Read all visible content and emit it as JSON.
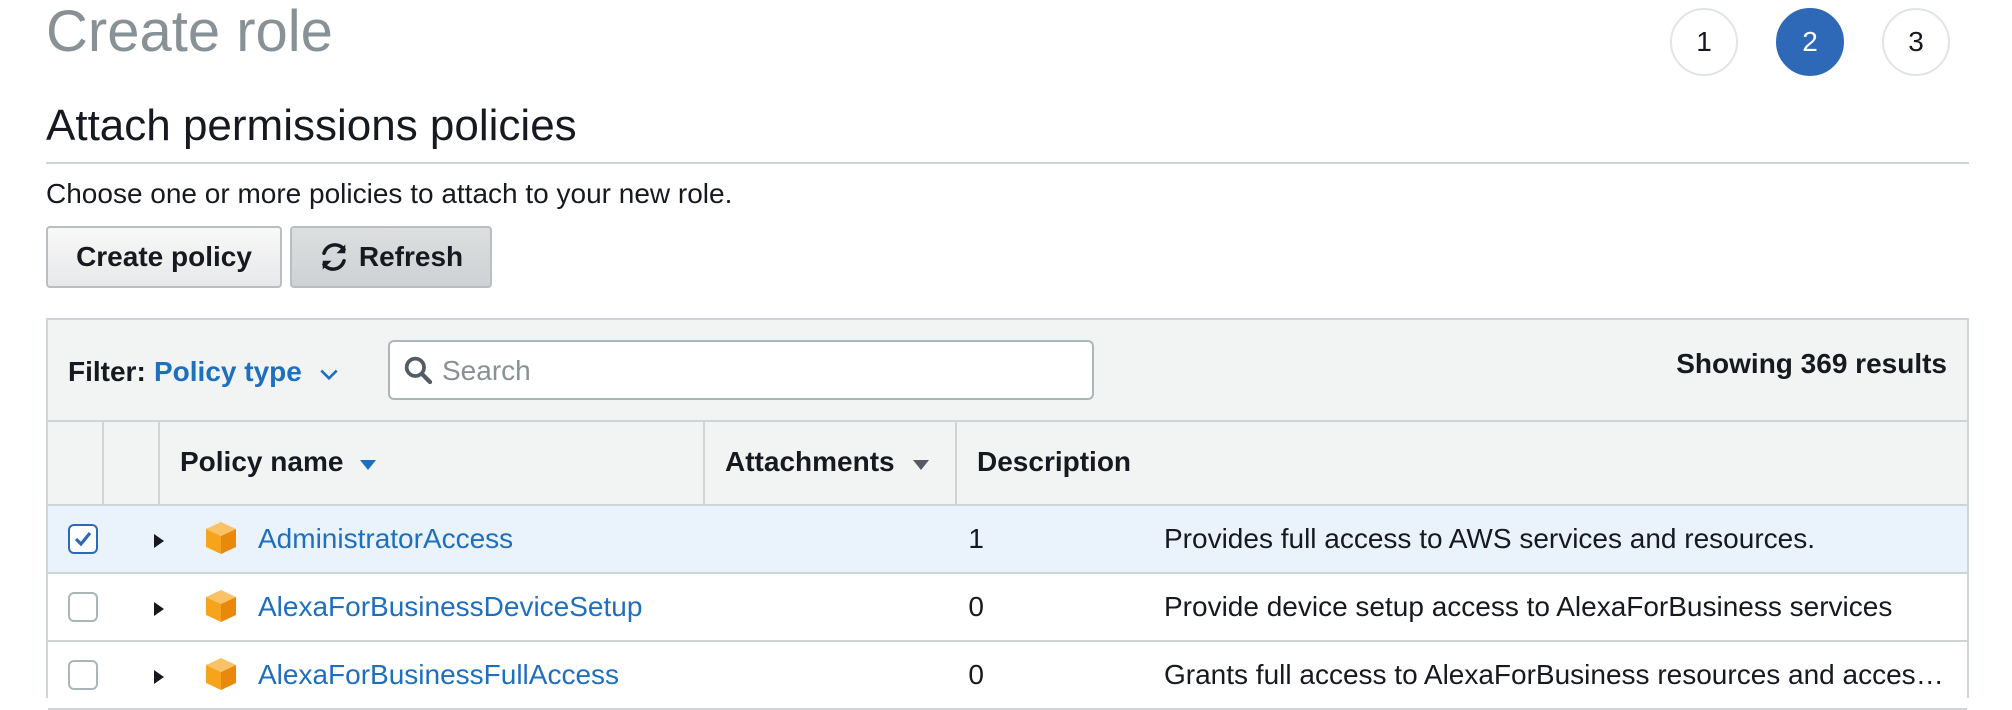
{
  "page": {
    "title": "Create role"
  },
  "steps": [
    {
      "label": "1"
    },
    {
      "label": "2"
    },
    {
      "label": "3"
    }
  ],
  "active_step": "2",
  "section": {
    "heading": "Attach permissions policies",
    "help_text": "Choose one or more policies to attach to your new role."
  },
  "toolbar": {
    "create_label": "Create policy",
    "refresh_label": "Refresh"
  },
  "filter": {
    "label": "Filter:",
    "value": "Policy type",
    "search_placeholder": "Search",
    "results_text": "Showing 369 results"
  },
  "table": {
    "columns": {
      "name": "Policy name",
      "attachments": "Attachments",
      "description": "Description"
    },
    "rows": [
      {
        "name": "AdministratorAccess",
        "attachments": "1",
        "description": "Provides full access to AWS services and resources.",
        "checked": true
      },
      {
        "name": "AlexaForBusinessDeviceSetup",
        "attachments": "0",
        "description": "Provide device setup access to AlexaForBusiness services",
        "checked": false
      },
      {
        "name": "AlexaForBusinessFullAccess",
        "attachments": "0",
        "description": "Grants full access to AlexaForBusiness resources and access to related AWS Services",
        "checked": false
      }
    ]
  },
  "colors": {
    "accent": "#2e69b7",
    "link": "#1f6fbf",
    "selected_row": "#eaf3fc",
    "icon_orange": "#f7a41d"
  },
  "icons": {
    "refresh": "refresh-icon",
    "search": "search-icon",
    "chevron": "chevron-down-icon",
    "sort": "sort-down-icon",
    "expand": "caret-right-icon",
    "package": "package-icon",
    "check": "check-icon"
  }
}
